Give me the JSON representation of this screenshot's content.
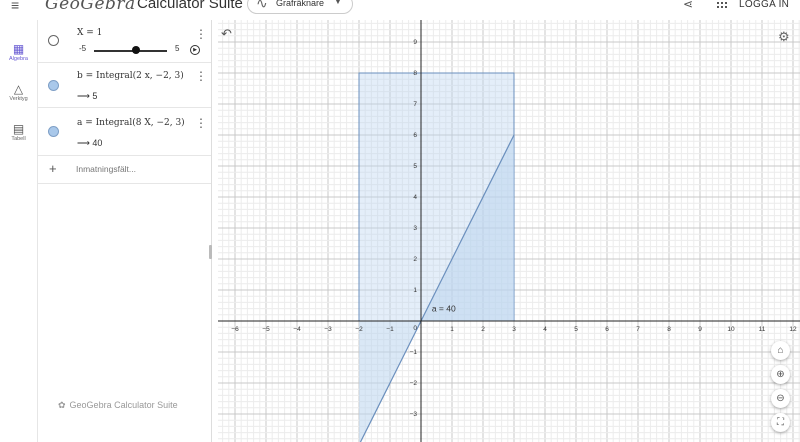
{
  "header": {
    "logo": "GeoGebra",
    "suite_title": "Calculator Suite",
    "app_selector": "Grafräknare",
    "login": "LOGGA IN"
  },
  "left_toolbar": {
    "items": [
      {
        "label": "Algebra",
        "icon": "calculator-icon",
        "active": true
      },
      {
        "label": "Verktyg",
        "icon": "tools-icon",
        "active": false
      },
      {
        "label": "Tabell",
        "icon": "table-icon",
        "active": false
      }
    ]
  },
  "algebra": {
    "rows": [
      {
        "expression": "X = 1",
        "slider": {
          "min": "-5",
          "max": "5",
          "value": 1
        },
        "visible": false
      },
      {
        "expression": "b = Integral(2 x, −2, 3)",
        "result": "⟶ 5",
        "visible": true
      },
      {
        "expression": "a = Integral(8 X, −2, 3)",
        "result": "⟶ 40",
        "visible": true
      }
    ],
    "input_placeholder": "Inmatningsfält...",
    "footer": "GeoGebra Calculator Suite"
  },
  "graph": {
    "x_min": -7,
    "x_max": 12,
    "y_min": -4,
    "y_max": 9.6,
    "x_ticks": [
      "−6",
      "−5",
      "−4",
      "−3",
      "−2",
      "−1",
      "1",
      "2",
      "3",
      "4",
      "5",
      "6",
      "7",
      "8",
      "9",
      "10",
      "11",
      "12"
    ],
    "y_ticks": [
      "9",
      "8",
      "7",
      "6",
      "5",
      "4",
      "3",
      "2",
      "1",
      "−1",
      "−2",
      "−3"
    ],
    "origin_label": "0",
    "rect_integral": {
      "x_from": -2,
      "x_to": 3,
      "height": 8
    },
    "line_integral": {
      "slope": 2,
      "x_from": -2,
      "x_to": 3
    },
    "label_text": "a = 40",
    "fill_color": "#bcd5ef",
    "stroke_color": "#6a8fbd"
  }
}
